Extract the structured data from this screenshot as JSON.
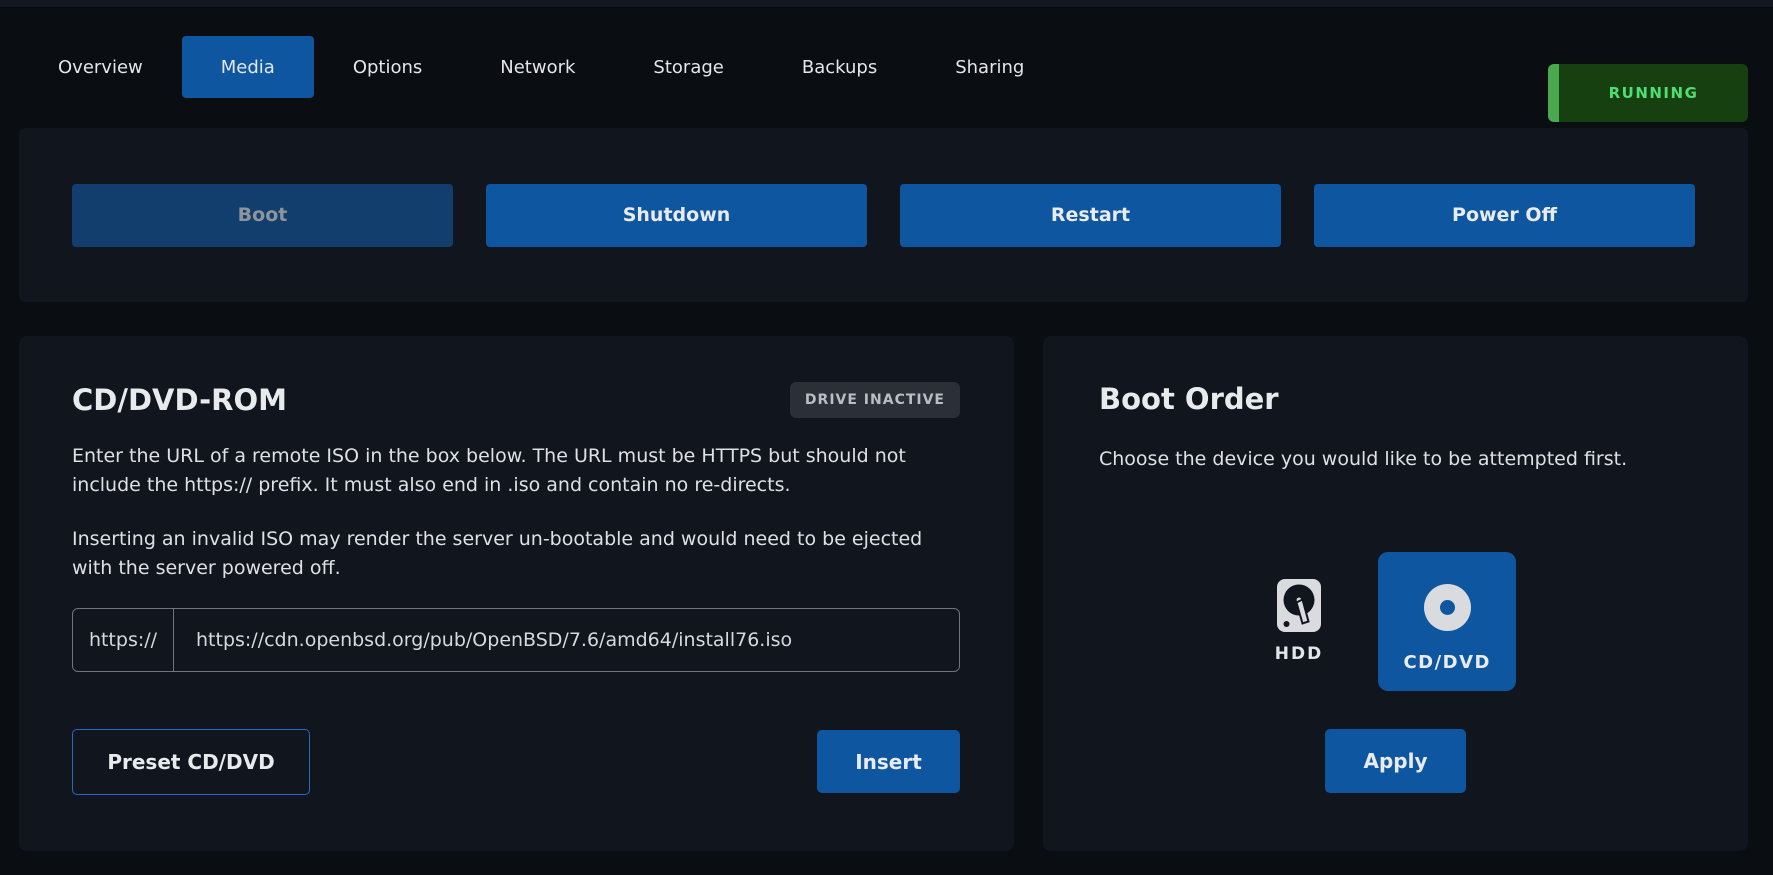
{
  "header": {
    "tabs": [
      {
        "label": "Overview",
        "active": false
      },
      {
        "label": "Media",
        "active": true
      },
      {
        "label": "Options",
        "active": false
      },
      {
        "label": "Network",
        "active": false
      },
      {
        "label": "Storage",
        "active": false
      },
      {
        "label": "Backups",
        "active": false
      },
      {
        "label": "Sharing",
        "active": false
      }
    ],
    "status": {
      "label": "RUNNING"
    }
  },
  "power_controls": {
    "buttons": [
      {
        "label": "Boot",
        "disabled": true
      },
      {
        "label": "Shutdown",
        "disabled": false
      },
      {
        "label": "Restart",
        "disabled": false
      },
      {
        "label": "Power Off",
        "disabled": false
      }
    ]
  },
  "cdrom_card": {
    "title": "CD/DVD-ROM",
    "status_badge": "DRIVE INACTIVE",
    "instructions": "Enter the URL of a remote ISO in the box below. The URL must be HTTPS but should not include the https:// prefix. It must also end in .iso and contain no re-directs.",
    "warning": "Inserting an invalid ISO may render the server un-bootable and would need to be ejected with the server powered off.",
    "url_prefix": "https://",
    "url_value": "https://cdn.openbsd.org/pub/OpenBSD/7.6/amd64/install76.iso",
    "preset_button": "Preset CD/DVD",
    "insert_button": "Insert"
  },
  "boot_order_card": {
    "title": "Boot Order",
    "description": "Choose the device you would like to be attempted first.",
    "devices": [
      {
        "label": "HDD",
        "icon": "hdd-icon",
        "selected": false
      },
      {
        "label": "CD/DVD",
        "icon": "disc-icon",
        "selected": true
      }
    ],
    "apply_button": "Apply"
  },
  "colors": {
    "primary_blue": "#0e57a0",
    "disabled_button_blue": "#123e6e",
    "page_background": "#0a0d12",
    "card_background": "#10151e",
    "running_badge_bg": "#16400f",
    "running_badge_strip": "#4aa850",
    "running_text": "#4fdd74",
    "badge_gray_bg": "#2b2f37"
  }
}
